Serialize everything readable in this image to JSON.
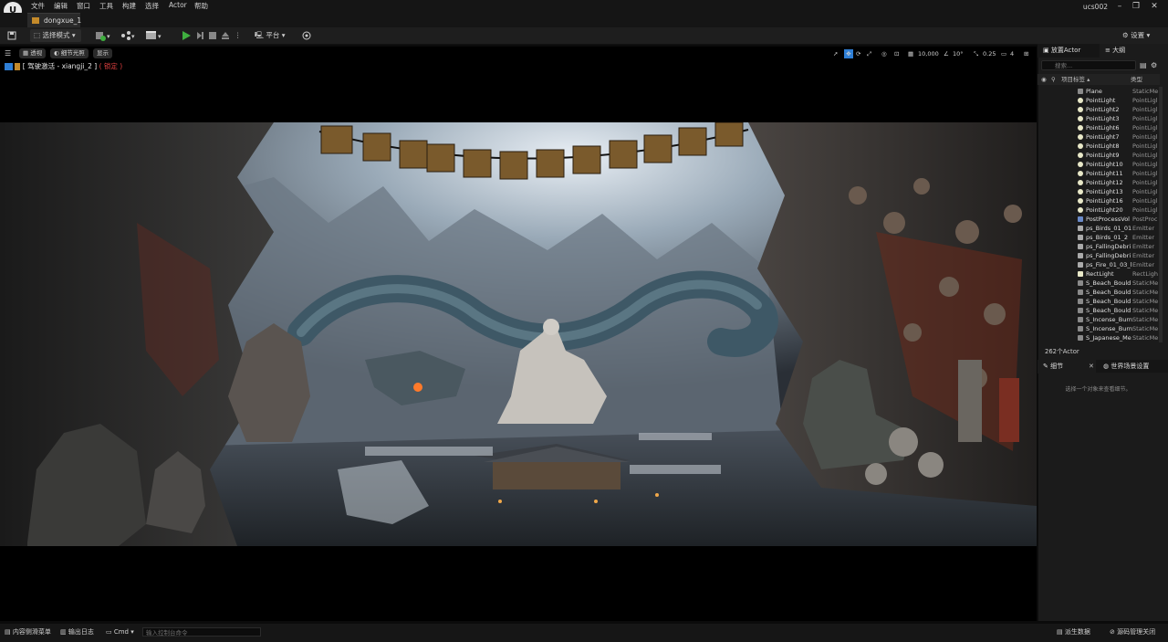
{
  "app": {
    "logo_text": "U",
    "user": "ucs002"
  },
  "menu": [
    {
      "label": "文件"
    },
    {
      "label": "编辑"
    },
    {
      "label": "窗口"
    },
    {
      "label": "工具"
    },
    {
      "label": "构建"
    },
    {
      "label": "选择"
    },
    {
      "label": "Actor"
    },
    {
      "label": "帮助"
    }
  ],
  "window_controls": {
    "minimize": "–",
    "maximize": "❐",
    "close": "✕"
  },
  "tabs": [
    {
      "label": "dongxue_1"
    }
  ],
  "toolbar": {
    "select_mode": "选择模式",
    "platform": "平台",
    "settings": "设置"
  },
  "viewport": {
    "perspective": "透视",
    "lighting": "细节光照",
    "show": "显示",
    "pilot_prefix": "[ 驾驶激活 - xiangji_2 ]",
    "pilot_locked": "( 锁定 )",
    "grid_snap": "10,000",
    "angle_snap": "10°",
    "scale_snap": "0.25",
    "camera_speed": "4"
  },
  "outliner": {
    "tab_place": "放置Actor",
    "tab_outliner": "大纲",
    "search_placeholder": "搜索...",
    "col_label": "项目标签 ▴",
    "col_type": "类型",
    "rows": [
      {
        "name": "Plane",
        "type": "StaticMe",
        "icon": "mesh-icon"
      },
      {
        "name": "PointLight",
        "type": "PointLigl",
        "icon": "light-icon"
      },
      {
        "name": "PointLight2",
        "type": "PointLigl",
        "icon": "light-icon"
      },
      {
        "name": "PointLight3",
        "type": "PointLigl",
        "icon": "light-icon"
      },
      {
        "name": "PointLight6",
        "type": "PointLigl",
        "icon": "light-icon"
      },
      {
        "name": "PointLight7",
        "type": "PointLigl",
        "icon": "light-icon"
      },
      {
        "name": "PointLight8",
        "type": "PointLigl",
        "icon": "light-icon"
      },
      {
        "name": "PointLight9",
        "type": "PointLigl",
        "icon": "light-icon"
      },
      {
        "name": "PointLight10",
        "type": "PointLigl",
        "icon": "light-icon"
      },
      {
        "name": "PointLight11",
        "type": "PointLigl",
        "icon": "light-icon"
      },
      {
        "name": "PointLight12",
        "type": "PointLigl",
        "icon": "light-icon"
      },
      {
        "name": "PointLight13",
        "type": "PointLigl",
        "icon": "light-icon"
      },
      {
        "name": "PointLight16",
        "type": "PointLigl",
        "icon": "light-icon"
      },
      {
        "name": "PointLight20",
        "type": "PointLigl",
        "icon": "light-icon"
      },
      {
        "name": "PostProcessVol",
        "type": "PostProc",
        "icon": "volume-icon"
      },
      {
        "name": "ps_Birds_01_01",
        "type": "Emitter",
        "icon": "emitter-icon"
      },
      {
        "name": "ps_Birds_01_2",
        "type": "Emitter",
        "icon": "emitter-icon"
      },
      {
        "name": "ps_FallingDebri",
        "type": "Emitter",
        "icon": "emitter-icon"
      },
      {
        "name": "ps_FallingDebri",
        "type": "Emitter",
        "icon": "emitter-icon"
      },
      {
        "name": "ps_Fire_01_03_l",
        "type": "Emitter",
        "icon": "emitter-icon"
      },
      {
        "name": "RectLight",
        "type": "RectLigh",
        "icon": "rectlight-icon"
      },
      {
        "name": "S_Beach_Bould",
        "type": "StaticMe",
        "icon": "mesh-icon"
      },
      {
        "name": "S_Beach_Bould",
        "type": "StaticMe",
        "icon": "mesh-icon"
      },
      {
        "name": "S_Beach_Bould",
        "type": "StaticMe",
        "icon": "mesh-icon"
      },
      {
        "name": "S_Beach_Bould",
        "type": "StaticMe",
        "icon": "mesh-icon"
      },
      {
        "name": "S_Incense_Burn",
        "type": "StaticMe",
        "icon": "mesh-icon"
      },
      {
        "name": "S_Incense_Burn",
        "type": "StaticMe",
        "icon": "mesh-icon"
      },
      {
        "name": "S_Japanese_Me",
        "type": "StaticMe",
        "icon": "mesh-icon"
      }
    ],
    "actor_count": "262个Actor"
  },
  "details": {
    "tab_details": "细节",
    "tab_world": "世界场景设置",
    "empty_hint": "选择一个对象来查看细节。"
  },
  "statusbar": {
    "content_drawer": "内容侧滑菜单",
    "output_log": "输出日志",
    "cmd": "Cmd",
    "cmd_placeholder": "输入控制台命令",
    "derived_data": "派生数据",
    "source_control": "源码管理关闭"
  },
  "colors": {
    "accent": "#2f7fd6",
    "locked": "#e24040",
    "play": "#3fae3f"
  }
}
